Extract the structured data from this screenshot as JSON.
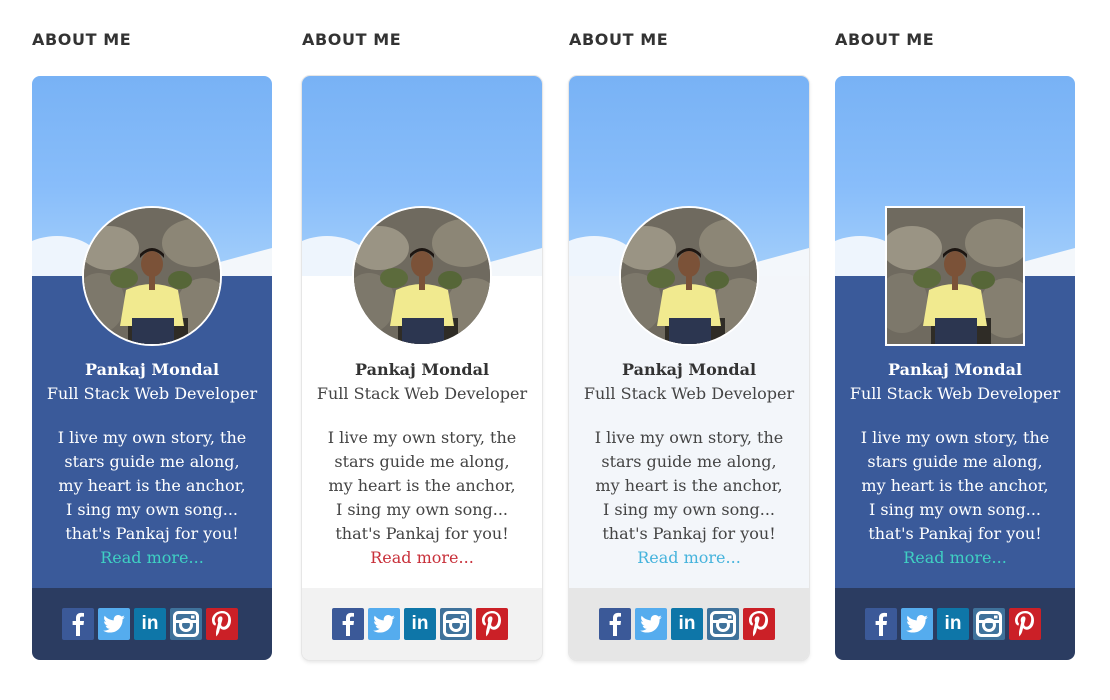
{
  "colors": {
    "blue_body": "#3a5a9a",
    "dark_footer": "#2b3c61",
    "light_footer": "#f2f2f2",
    "gray_footer": "#e6e6e6",
    "white_body": "#ffffff",
    "pale_body": "#f3f6fa",
    "link_teal": "#3fd0c3",
    "link_red": "#c8303a",
    "link_blue": "#45b3dc",
    "facebook": "#3b5998",
    "twitter": "#55acee",
    "linkedin": "#0e76a8",
    "instagram": "#3f729b",
    "pinterest": "#cb2027"
  },
  "social_icons": [
    "facebook-icon",
    "twitter-icon",
    "linkedin-icon",
    "instagram-icon",
    "pinterest-icon"
  ],
  "cards": [
    {
      "heading": "ABOUT ME",
      "name": "Pankaj Mondal",
      "role": "Full Stack Web Developer",
      "bio": "I live my own story, the stars guide me along, my heart is the anchor, I sing my own song... that's Pankaj for you!",
      "read_more": "Read more...",
      "avatar_shape": "round",
      "theme": "blue"
    },
    {
      "heading": "ABOUT ME",
      "name": "Pankaj Mondal",
      "role": "Full Stack Web Developer",
      "bio": "I live my own story, the stars guide me along, my heart is the anchor, I sing my own song... that's Pankaj for you!",
      "read_more": "Read more...",
      "avatar_shape": "round",
      "theme": "white"
    },
    {
      "heading": "ABOUT ME",
      "name": "Pankaj Mondal",
      "role": "Full Stack Web Developer",
      "bio": "I live my own story, the stars guide me along, my heart is the anchor, I sing my own song... that's Pankaj for you!",
      "read_more": "Read more...",
      "avatar_shape": "round",
      "theme": "pale"
    },
    {
      "heading": "ABOUT ME",
      "name": "Pankaj Mondal",
      "role": "Full Stack Web Developer",
      "bio": "I live my own story, the stars guide me along, my heart is the anchor, I sing my own song... that's Pankaj for you!",
      "read_more": "Read more...",
      "avatar_shape": "square",
      "theme": "blue"
    }
  ]
}
